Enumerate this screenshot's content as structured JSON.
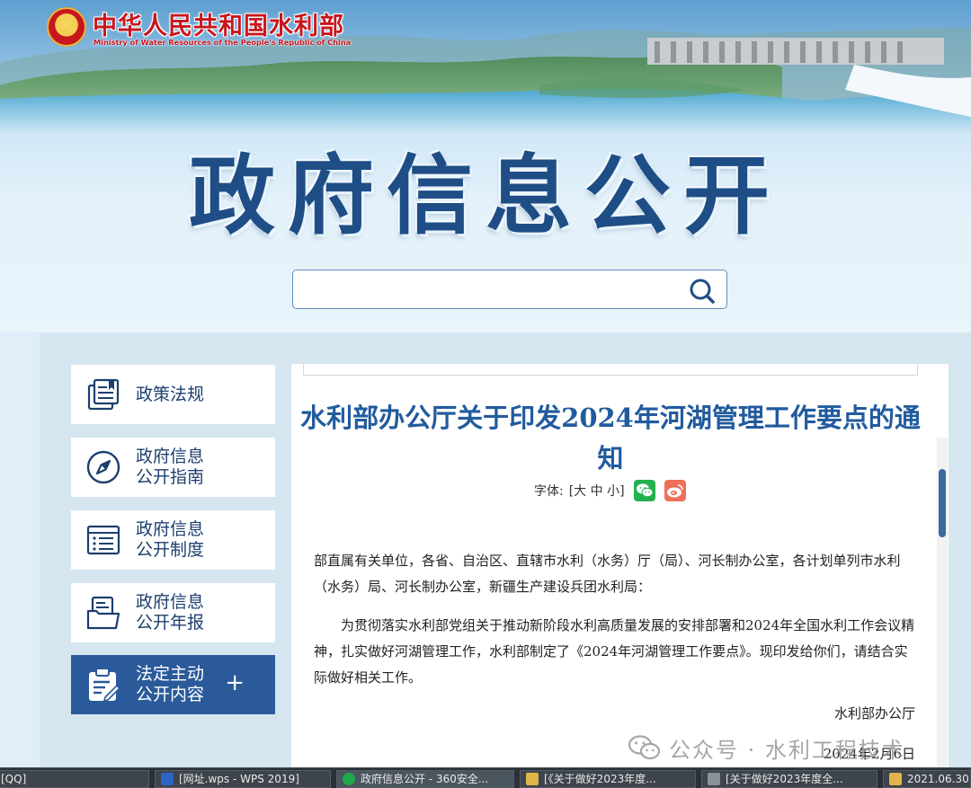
{
  "header": {
    "ministry_cn": "中华人民共和国水利部",
    "ministry_en": "Ministry of Water Resources of the People's Republic of China",
    "big_title": "政府信息公开"
  },
  "search": {
    "value": "",
    "placeholder": ""
  },
  "sidebar": {
    "items": [
      {
        "label": "政策法规",
        "icon": "book-icon"
      },
      {
        "label": "政府信息公开指南",
        "icon": "compass-icon"
      },
      {
        "label": "政府信息公开制度",
        "icon": "list-doc-icon"
      },
      {
        "label": "政府信息公开年报",
        "icon": "folder-doc-icon"
      },
      {
        "label": "法定主动公开内容",
        "icon": "clipboard-edit-icon",
        "active": true,
        "expand": "+"
      }
    ]
  },
  "article": {
    "title": "水利部办公厅关于印发2024年河湖管理工作要点的通知",
    "font_label": "字体:",
    "font_sizes": "[大 中 小]",
    "salutation": "部直属有关单位，各省、自治区、直辖市水利（水务）厅（局）、河长制办公室，各计划单列市水利（水务）局、河长制办公室，新疆生产建设兵团水利局：",
    "paragraph": "为贯彻落实水利部党组关于推动新阶段水利高质量发展的安排部署和2024年全国水利工作会议精神，扎实做好河湖管理工作，水利部制定了《2024年河湖管理工作要点》。现印发给你们，请结合实际做好相关工作。",
    "signer": "水利部办公厅",
    "date": "2024年2月6日"
  },
  "watermark": {
    "text": "公众号 · 水利工程技术"
  },
  "taskbar": {
    "items": [
      {
        "label": "[QQ]"
      },
      {
        "label": "[网址.wps - WPS 2019]"
      },
      {
        "label": "政府信息公开 - 360安全..."
      },
      {
        "label": "[《关于做好2023年度..."
      },
      {
        "label": "[关于做好2023年度全..."
      },
      {
        "label": "2021.06.30"
      }
    ]
  },
  "colors": {
    "brand_red": "#c8161d",
    "title_blue": "#215b9e",
    "nav_active": "#2a5a9a"
  }
}
